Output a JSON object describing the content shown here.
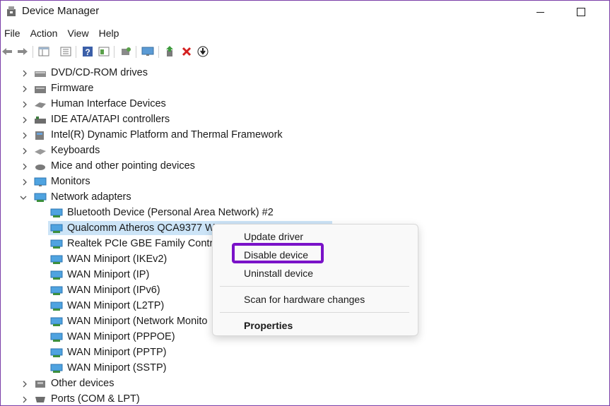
{
  "window": {
    "title": "Device Manager"
  },
  "menubar": {
    "items": [
      "File",
      "Action",
      "View",
      "Help"
    ]
  },
  "toolbar": {
    "icons": [
      "back-arrow-icon",
      "forward-arrow-icon",
      "properties-pane-icon",
      "list-view-icon",
      "help-icon",
      "action-pane-icon",
      "scan-hardware-icon",
      "monitor-icon",
      "update-driver-icon",
      "uninstall-icon",
      "disable-icon"
    ]
  },
  "tree": {
    "categories": [
      {
        "label": "DVD/CD-ROM drives",
        "expanded": false
      },
      {
        "label": "Firmware",
        "expanded": false
      },
      {
        "label": "Human Interface Devices",
        "expanded": false
      },
      {
        "label": "IDE ATA/ATAPI controllers",
        "expanded": false
      },
      {
        "label": "Intel(R) Dynamic Platform and Thermal Framework",
        "expanded": false
      },
      {
        "label": "Keyboards",
        "expanded": false
      },
      {
        "label": "Mice and other pointing devices",
        "expanded": false
      },
      {
        "label": "Monitors",
        "expanded": false
      },
      {
        "label": "Network adapters",
        "expanded": true
      }
    ],
    "network_adapters": [
      "Bluetooth Device (Personal Area Network) #2",
      "Qualcomm Atheros QCA9377 W",
      "Realtek PCIe GBE Family Contro",
      "WAN Miniport (IKEv2)",
      "WAN Miniport (IP)",
      "WAN Miniport (IPv6)",
      "WAN Miniport (L2TP)",
      "WAN Miniport (Network Monito",
      "WAN Miniport (PPPOE)",
      "WAN Miniport (PPTP)",
      "WAN Miniport (SSTP)"
    ],
    "trailing_categories": [
      {
        "label": "Other devices",
        "expanded": false
      },
      {
        "label": "Ports (COM & LPT)",
        "expanded": false
      }
    ]
  },
  "context_menu": {
    "update_driver": "Update driver",
    "disable_device": "Disable device",
    "uninstall_device": "Uninstall device",
    "scan_hardware": "Scan for hardware changes",
    "properties": "Properties"
  },
  "colors": {
    "highlight": "#7a12c8",
    "selection": "#cce4f7"
  }
}
